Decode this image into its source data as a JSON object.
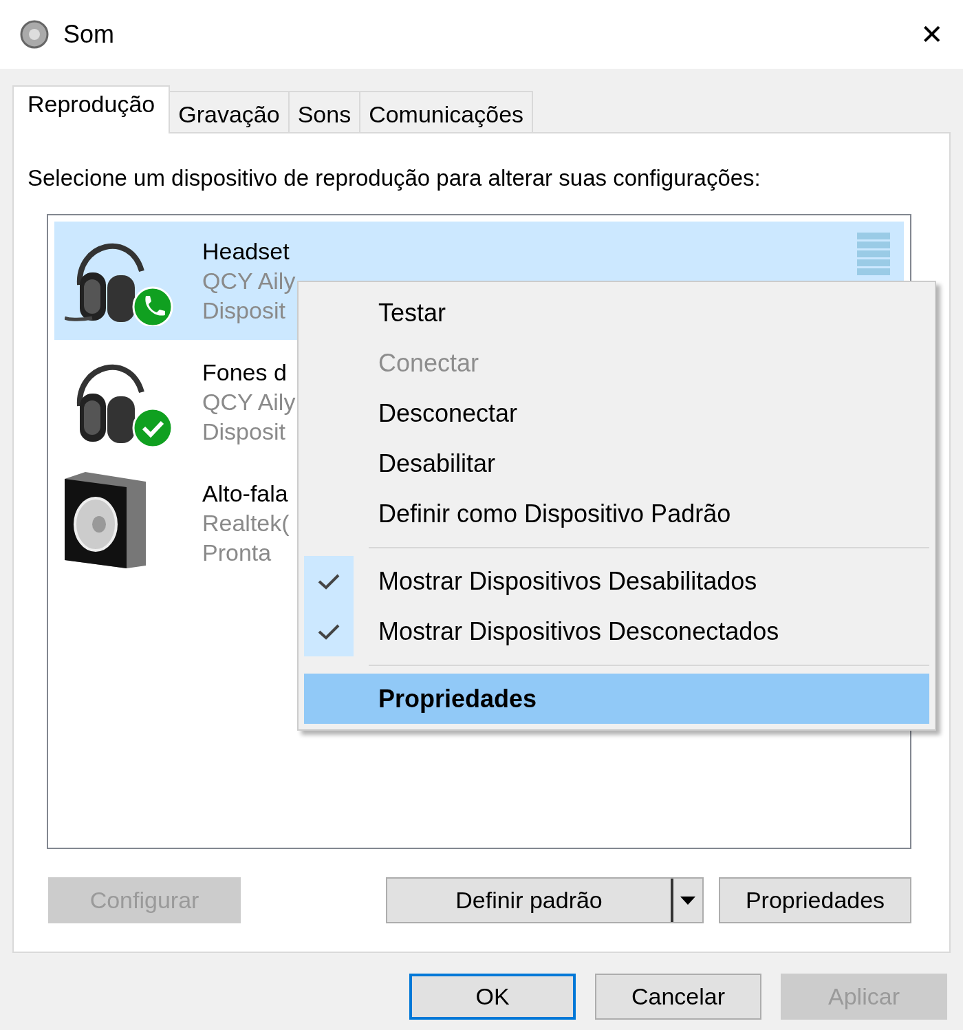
{
  "window": {
    "title": "Som",
    "close": "✕"
  },
  "tabs": [
    {
      "label": "Reprodução",
      "selected": true
    },
    {
      "label": "Gravação",
      "selected": false
    },
    {
      "label": "Sons",
      "selected": false
    },
    {
      "label": "Comunicações",
      "selected": false
    }
  ],
  "instruction": "Selecione um dispositivo de reprodução para alterar suas configurações:",
  "devices": [
    {
      "kind": "headset",
      "name": "Headset",
      "description": "QCY Aily",
      "status": "Disposit",
      "selected": true
    },
    {
      "kind": "headphones",
      "name": "Fones d",
      "description": "QCY Aily",
      "status": "Disposit",
      "selected": false
    },
    {
      "kind": "speaker",
      "name": "Alto-fala",
      "description": "Realtek(",
      "status": "Pronta",
      "selected": false
    }
  ],
  "context_menu": [
    {
      "kind": "item",
      "label": "Testar",
      "disabled": false,
      "checked": false,
      "selected": false,
      "default": false
    },
    {
      "kind": "item",
      "label": "Conectar",
      "disabled": true,
      "checked": false,
      "selected": false,
      "default": false
    },
    {
      "kind": "item",
      "label": "Desconectar",
      "disabled": false,
      "checked": false,
      "selected": false,
      "default": false
    },
    {
      "kind": "item",
      "label": "Desabilitar",
      "disabled": false,
      "checked": false,
      "selected": false,
      "default": false
    },
    {
      "kind": "item",
      "label": "Definir como Dispositivo Padrão",
      "disabled": false,
      "checked": false,
      "selected": false,
      "default": false
    },
    {
      "kind": "separator"
    },
    {
      "kind": "item",
      "label": "Mostrar Dispositivos Desabilitados",
      "disabled": false,
      "checked": true,
      "selected": false,
      "default": false
    },
    {
      "kind": "item",
      "label": "Mostrar Dispositivos Desconectados",
      "disabled": false,
      "checked": true,
      "selected": false,
      "default": false
    },
    {
      "kind": "separator"
    },
    {
      "kind": "item",
      "label": "Propriedades",
      "disabled": false,
      "checked": false,
      "selected": true,
      "default": true
    }
  ],
  "panel_buttons": [
    {
      "kind": "button",
      "label": "Configurar",
      "disabled": true
    },
    {
      "kind": "split",
      "label": "Definir padrão",
      "disabled": false
    },
    {
      "kind": "button",
      "label": "Propriedades",
      "disabled": false
    }
  ],
  "dialog_buttons": [
    {
      "label": "OK",
      "disabled": false,
      "default": true
    },
    {
      "label": "Cancelar",
      "disabled": false,
      "default": false
    },
    {
      "label": "Aplicar",
      "disabled": true,
      "default": false
    }
  ]
}
